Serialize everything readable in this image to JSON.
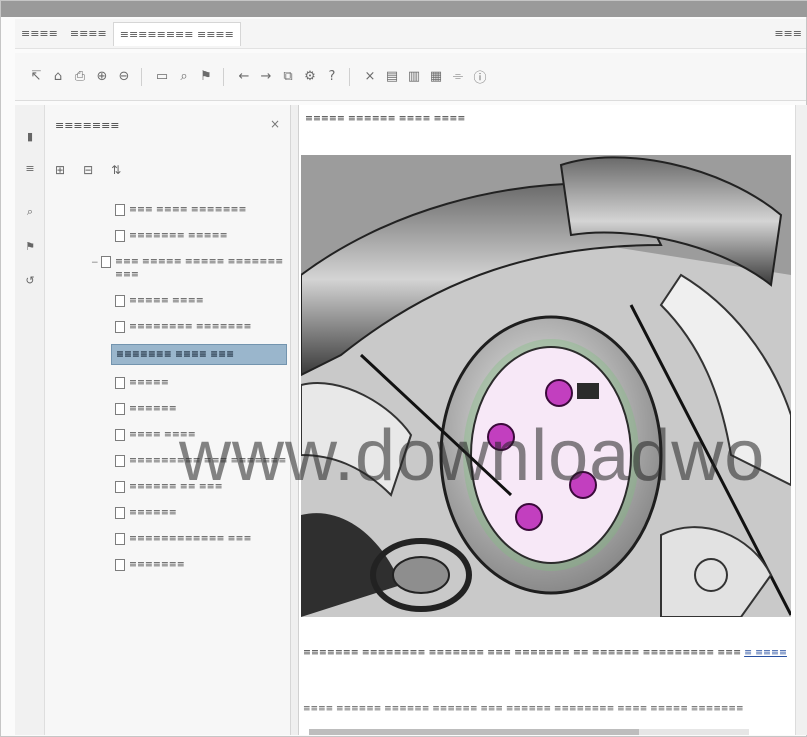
{
  "menubar": {
    "tabs": [
      "≡≡≡≡",
      "≡≡≡≡",
      "≡≡≡≡≡≡≡≡ ≡≡≡≡"
    ],
    "right_label": "≡≡≡"
  },
  "toolbar": {
    "icons": [
      "arrow-icon",
      "home-icon",
      "print-icon",
      "zoom-in-icon",
      "zoom-out-icon",
      "page-icon",
      "find-icon",
      "bookmark-icon",
      "back-icon",
      "forward-icon",
      "copy-icon",
      "settings-icon",
      "help-icon",
      "close-icon",
      "panel-icon",
      "layout-icon",
      "grid-icon",
      "filter-icon",
      "info-icon"
    ]
  },
  "panel": {
    "title": "≡≡≡≡≡≡≡",
    "close": "×"
  },
  "tree": {
    "items": [
      {
        "label": "≡≡≡ ≡≡≡≡ ≡≡≡≡≡≡≡",
        "selected": false
      },
      {
        "label": "≡≡≡≡≡≡≡ ≡≡≡≡≡",
        "selected": false
      },
      {
        "label": "≡≡≡ ≡≡≡≡≡ ≡≡≡≡≡ ≡≡≡≡≡≡≡ ≡≡≡",
        "selected": false
      },
      {
        "label": "≡≡≡≡≡ ≡≡≡≡",
        "selected": false
      },
      {
        "label": "≡≡≡≡≡≡≡≡ ≡≡≡≡≡≡≡",
        "selected": false
      },
      {
        "label": "≡≡≡≡≡≡≡ ≡≡≡≡ ≡≡≡",
        "selected": true
      },
      {
        "label": "≡≡≡≡≡",
        "selected": false
      },
      {
        "label": "≡≡≡≡≡≡",
        "selected": false
      },
      {
        "label": "≡≡≡≡ ≡≡≡≡",
        "selected": false
      },
      {
        "label": "≡≡≡≡≡≡≡≡≡ ≡≡≡ ≡≡≡≡≡≡≡",
        "selected": false
      },
      {
        "label": "≡≡≡≡≡≡ ≡≡ ≡≡≡",
        "selected": false
      },
      {
        "label": "≡≡≡≡≡≡",
        "selected": false
      },
      {
        "label": "≡≡≡≡≡≡≡≡≡≡≡≡ ≡≡≡",
        "selected": false
      },
      {
        "label": "≡≡≡≡≡≡≡",
        "selected": false
      }
    ]
  },
  "content": {
    "breadcrumb": "≡≡≡≡≡ ≡≡≡≡≡≡ ≡≡≡≡ ≡≡≡≡",
    "para1": "≡≡≡≡≡≡≡ ≡≡≡≡≡≡≡≡ ≡≡≡≡≡≡≡ ≡≡≡ ≡≡≡≡≡≡≡ ≡≡ ≡≡≡≡≡≡ ≡≡≡≡≡≡≡≡≡ ≡≡≡",
    "para1_link": "≡ ≡≡≡≡",
    "para2": "≡≡≡≡ ≡≡≡≡≡≡ ≡≡≡≡≡≡ ≡≡≡≡≡≡ ≡≡≡ ≡≡≡≡≡≡ ≡≡≡≡≡≡≡≡ ≡≡≡≡ ≡≡≡≡≡ ≡≡≡≡≡≡≡"
  },
  "illustration": {
    "highlight_color": "#c23fbf",
    "inner_circle_fill": "#f7e8f7"
  },
  "watermark": {
    "text": "www.downloadwo"
  }
}
